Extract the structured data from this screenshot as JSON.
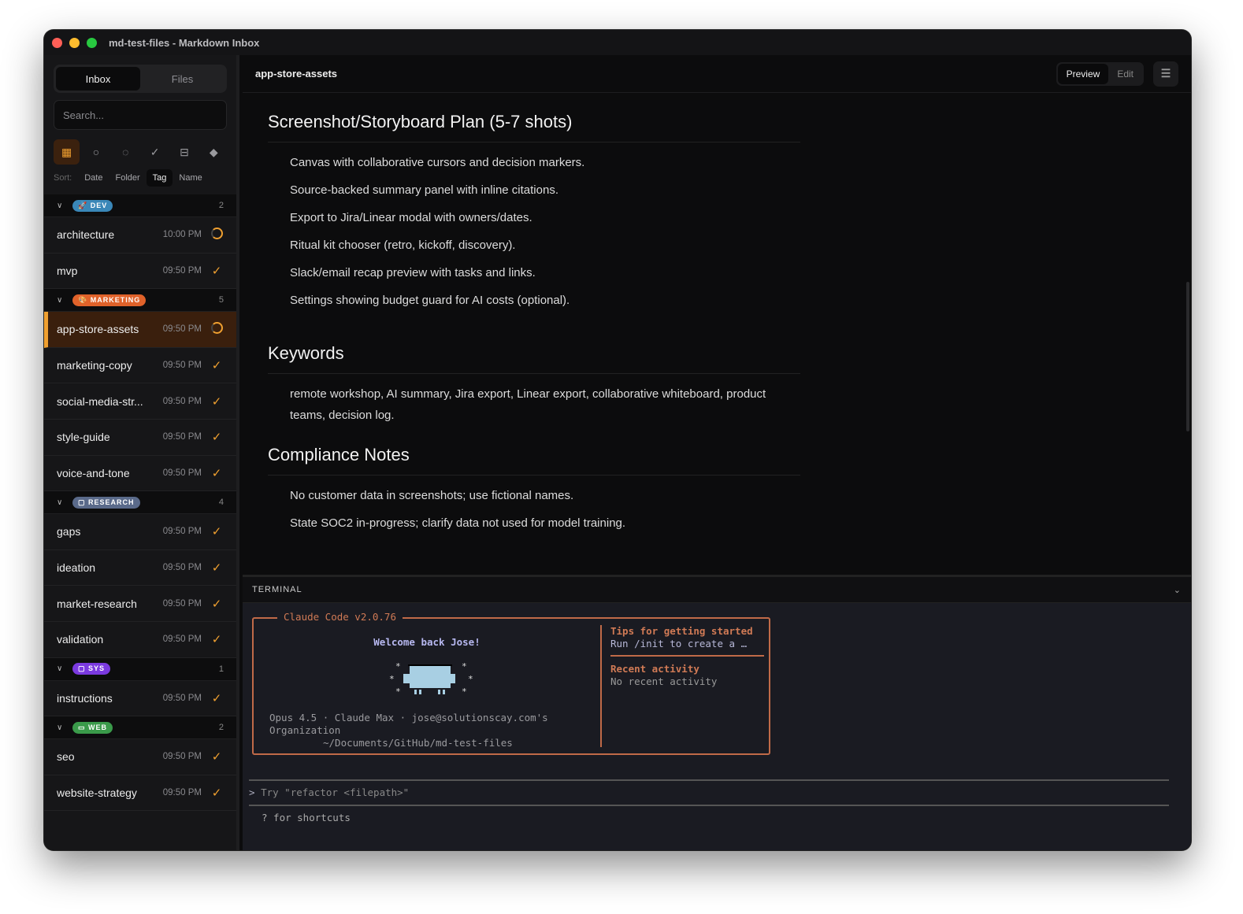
{
  "window": {
    "title": "md-test-files - Markdown Inbox"
  },
  "sidebar": {
    "tabs": [
      "Inbox",
      "Files"
    ],
    "search_placeholder": "Search...",
    "filters": [
      "all-grid-icon",
      "circle-icon",
      "in-progress-icon",
      "check-icon",
      "archive-icon",
      "tag-icon"
    ],
    "sort": {
      "label": "Sort:",
      "options": [
        "Date",
        "Folder",
        "Tag",
        "Name"
      ],
      "active": "Tag"
    },
    "groups": [
      {
        "tag": "DEV",
        "color": "#3a87b8",
        "count": "2",
        "items": [
          {
            "name": "architecture",
            "time": "10:00 PM",
            "status": "in-progress"
          },
          {
            "name": "mvp",
            "time": "09:50 PM",
            "status": "done"
          }
        ]
      },
      {
        "tag": "MARKETING",
        "color": "#e0622a",
        "count": "5",
        "items": [
          {
            "name": "app-store-assets",
            "time": "09:50 PM",
            "status": "in-progress",
            "selected": true
          },
          {
            "name": "marketing-copy",
            "time": "09:50 PM",
            "status": "done"
          },
          {
            "name": "social-media-str...",
            "time": "09:50 PM",
            "status": "done"
          },
          {
            "name": "style-guide",
            "time": "09:50 PM",
            "status": "done"
          },
          {
            "name": "voice-and-tone",
            "time": "09:50 PM",
            "status": "done"
          }
        ]
      },
      {
        "tag": "RESEARCH",
        "color": "#5a6a8a",
        "count": "4",
        "items": [
          {
            "name": "gaps",
            "time": "09:50 PM",
            "status": "done"
          },
          {
            "name": "ideation",
            "time": "09:50 PM",
            "status": "done"
          },
          {
            "name": "market-research",
            "time": "09:50 PM",
            "status": "done"
          },
          {
            "name": "validation",
            "time": "09:50 PM",
            "status": "done"
          }
        ]
      },
      {
        "tag": "SYS",
        "color": "#7b3ae0",
        "count": "1",
        "items": [
          {
            "name": "instructions",
            "time": "09:50 PM",
            "status": "done"
          }
        ]
      },
      {
        "tag": "WEB",
        "color": "#3a9a4a",
        "count": "2",
        "items": [
          {
            "name": "seo",
            "time": "09:50 PM",
            "status": "done"
          },
          {
            "name": "website-strategy",
            "time": "09:50 PM",
            "status": "done"
          }
        ]
      }
    ]
  },
  "header": {
    "doc_title": "app-store-assets",
    "preview": "Preview",
    "edit": "Edit"
  },
  "doc": {
    "h1": "Screenshot/Storyboard Plan (5-7 shots)",
    "shots": [
      "Canvas with collaborative cursors and decision markers.",
      "Source-backed summary panel with inline citations.",
      "Export to Jira/Linear modal with owners/dates.",
      "Ritual kit chooser (retro, kickoff, discovery).",
      "Slack/email recap preview with tasks and links.",
      "Settings showing budget guard for AI costs (optional)."
    ],
    "h2": "Keywords",
    "keywords": "remote workshop, AI summary, Jira export, Linear export, collaborative whiteboard, product teams, decision log.",
    "h3": "Compliance Notes",
    "compliance": [
      "No customer data in screenshots; use fictional names.",
      "State SOC2 in-progress; clarify data not used for model training."
    ]
  },
  "terminal": {
    "label": "TERMINAL",
    "box_title": "Claude Code v2.0.76",
    "welcome": "Welcome back Jose!",
    "info1": "Opus 4.5 · Claude Max · jose@solutionscay.com's Organization",
    "path": "~/Documents/GitHub/md-test-files",
    "tips_h": "Tips for getting started",
    "tips_v": "Run /init to create a …",
    "recent_h": "Recent activity",
    "recent_v": "No recent activity",
    "prompt": "Try \"refactor <filepath>\"",
    "shortcuts": "? for shortcuts"
  }
}
